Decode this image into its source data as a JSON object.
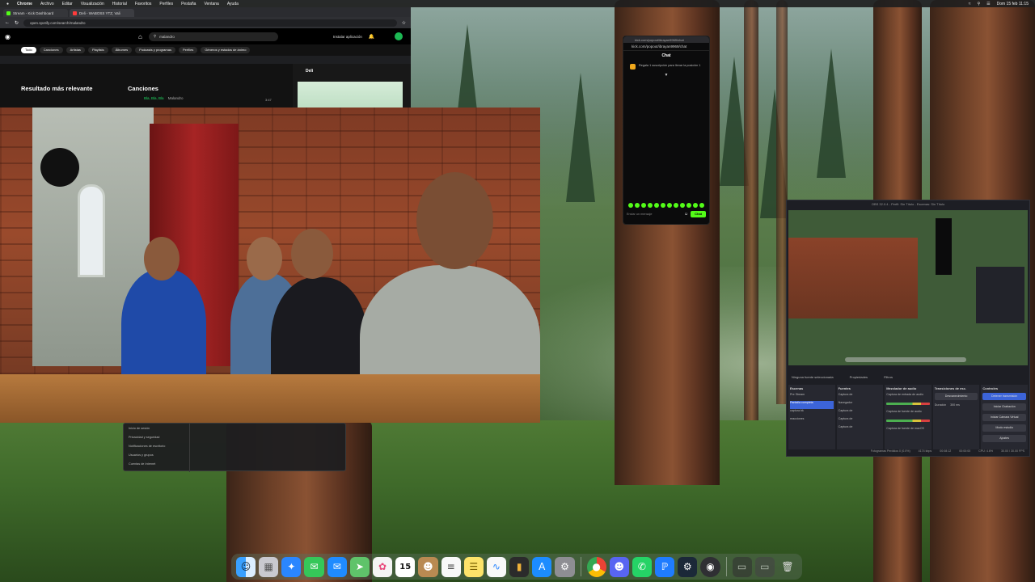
{
  "menubar": {
    "app": "Chrome",
    "items": [
      "Archivo",
      "Editar",
      "Visualización",
      "Historial",
      "Favoritos",
      "Perfiles",
      "Pestaña",
      "Ventana",
      "Ayuda"
    ],
    "clock": "Dom 15 feb 11:15"
  },
  "browser": {
    "tabs": [
      {
        "title": "Stream - Kick Dashboard",
        "favicon": "kick-icon"
      },
      {
        "title": "Deli - WABOSS YTZ, Vali",
        "favicon": "youtube-icon"
      }
    ],
    "url": "open.spotify.com/search/malandro"
  },
  "spotify": {
    "search_value": "malandro",
    "install_label": "Instalar aplicación",
    "filters": [
      "Todo",
      "Canciones",
      "Artistas",
      "Playlists",
      "Álbumes",
      "Podcasts y programas",
      "Perfiles",
      "Géneros y estados de ánimo"
    ],
    "active_filter": "Todo",
    "top_result_heading": "Resultado más relevante",
    "songs_heading": "Canciones",
    "song_title": "Bla, Bla, Bla",
    "song_artist": "Malandro",
    "song_duration": "3:47",
    "panel_title": "Deli"
  },
  "popup": {
    "items": [
      "Inicio de sesión",
      "Privacidad y seguridad",
      "Notificaciones de escritorio",
      "Usuarios y grupos",
      "Cuentas de Internet"
    ]
  },
  "chat": {
    "window_url": "kick.com/popout/ibrayan9969/chat",
    "header_url": "kick.com/popout/ibrayan9969/chat",
    "title": "Chat",
    "notice": "Regala 1 suscripción para llenar la posición 1",
    "input_placeholder": "Enviar un mensaje",
    "send_label": "Chat"
  },
  "obs": {
    "title": "OBS 32.0.4 - Perfil: Sin Título - Escenas: Sin Título",
    "source_label": "Ninguna fuente seleccionada",
    "properties_label": "Propiedades",
    "filters_label": "Filtros",
    "scenes_title": "Escenas",
    "scenes": [
      "Pre Stream",
      "Pantalla completa",
      "captura bk",
      "reacciones"
    ],
    "selected_scene": "Pantalla completa",
    "sources_title": "Fuentes",
    "sources": [
      "Captura de",
      "Navegador",
      "Captura de",
      "Captura de",
      "Captura de",
      "Captura de"
    ],
    "mixer_title": "Mezclador de audio",
    "mixer_items": [
      "Captura de entrada de audio",
      "Captura de fuente de audio",
      "Captura de fuente de macOS"
    ],
    "transitions_title": "Transiciones de esc.",
    "transition": "Desvanecimiento",
    "duration_label": "Duración",
    "duration_value": "300 ms",
    "controls_title": "Controles",
    "controls": [
      "Detener transmisión",
      "Iniciar Grabación",
      "Iniciar Cámara Virtual",
      "Modo estudio",
      "Ajustes"
    ],
    "status_items": [
      "Fotogramas Perdidos 0 (0.0%)",
      "4174 kbps",
      "00:08:12",
      "00:00:00",
      "CPU: 4.6%",
      "30.00 / 30.00 FPS"
    ]
  },
  "dock": {
    "apps": [
      "finder-icon",
      "launchpad-icon",
      "safari-icon",
      "messages-icon",
      "mail-icon",
      "maps-icon",
      "photos-icon",
      "calendar-icon",
      "notes-icon",
      "reminders-icon",
      "freeform-icon",
      "app-store-icon",
      "system-settings-icon",
      "chrome-icon",
      "discord-icon",
      "whatsapp-icon",
      "bluetooth-icon",
      "steam-icon",
      "obs-icon"
    ],
    "calendar_day": "15"
  }
}
